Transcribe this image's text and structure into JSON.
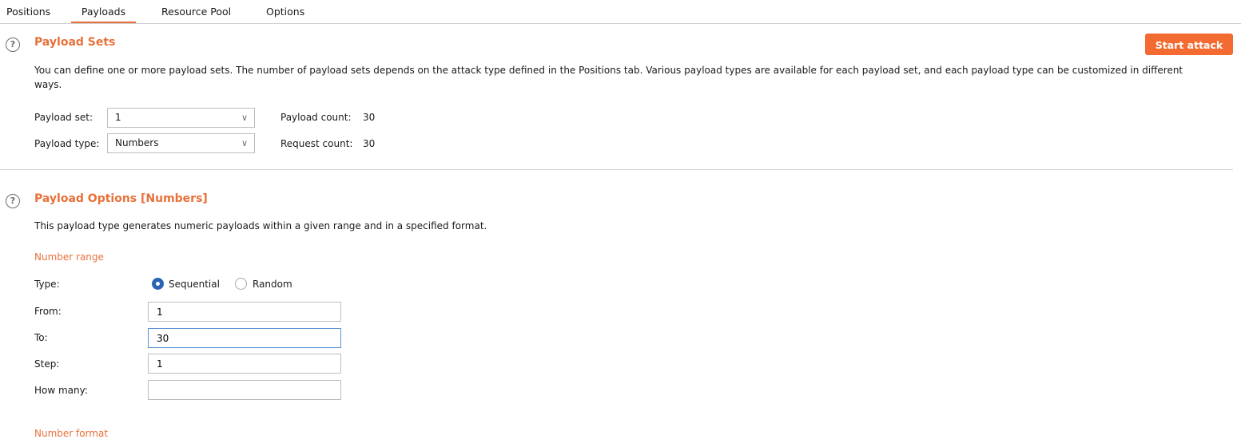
{
  "tabs": {
    "positions": "Positions",
    "payloads": "Payloads",
    "resource_pool": "Resource Pool",
    "options": "Options"
  },
  "payload_sets": {
    "title": "Payload Sets",
    "start_attack": "Start attack",
    "description": "You can define one or more payload sets. The number of payload sets depends on the attack type defined in the Positions tab. Various payload types are available for each payload set, and each payload type can be customized in different ways.",
    "set_label": "Payload set:",
    "set_value": "1",
    "type_label": "Payload type:",
    "type_value": "Numbers",
    "payload_count_label": "Payload count:",
    "payload_count": "30",
    "request_count_label": "Request count:",
    "request_count": "30"
  },
  "payload_options": {
    "title": "Payload Options [Numbers]",
    "description": "This payload type generates numeric payloads within a given range and in a specified format.",
    "number_range_title": "Number range",
    "type_label": "Type:",
    "sequential_label": "Sequential",
    "random_label": "Random",
    "selected_type": "Sequential",
    "from_label": "From:",
    "from_value": "1",
    "to_label": "To:",
    "to_value": "30",
    "step_label": "Step:",
    "step_value": "1",
    "how_many_label": "How many:",
    "how_many_value": "",
    "number_format_title": "Number format"
  },
  "colors": {
    "accent": "#e8703a",
    "button": "#f36b30",
    "radio_selected": "#2b63b5"
  },
  "icons": {
    "help": "help-circle-icon",
    "dropdown": "chevron-down-icon"
  }
}
